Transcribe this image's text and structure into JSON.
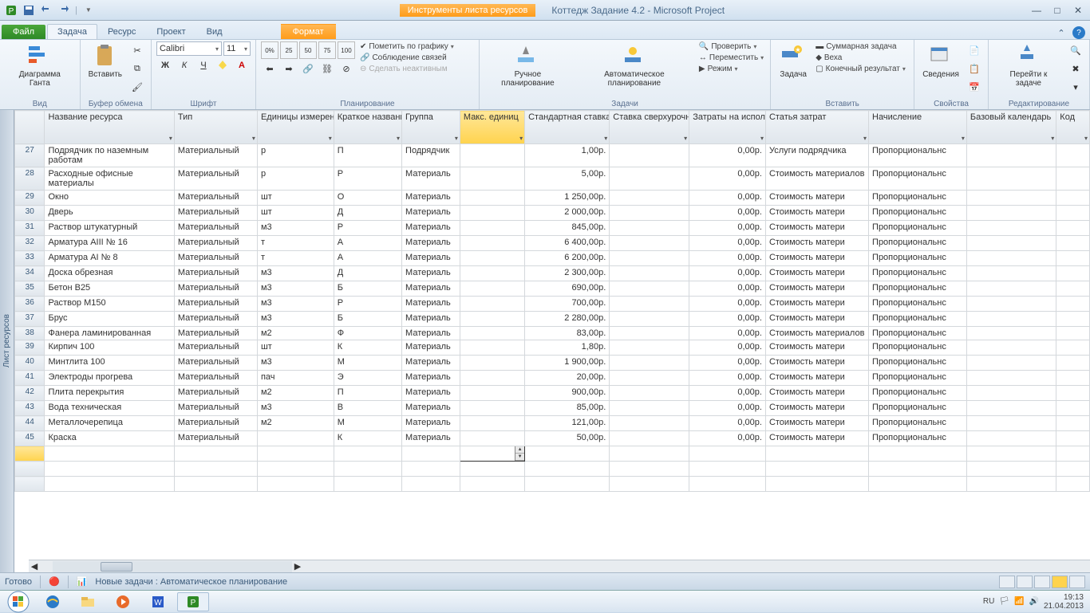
{
  "titlebar": {
    "tool_tab": "Инструменты листа ресурсов",
    "doc_title": "Коттедж Задание 4.2  -  Microsoft Project"
  },
  "tabs": {
    "file": "Файл",
    "items": [
      "Задача",
      "Ресурс",
      "Проект",
      "Вид"
    ],
    "active_index": 0,
    "format": "Формат"
  },
  "ribbon": {
    "view": {
      "gantt": "Диаграмма Ганта",
      "label": "Вид"
    },
    "clipboard": {
      "paste": "Вставить",
      "label": "Буфер обмена"
    },
    "font": {
      "name": "Calibri",
      "size": "11",
      "label": "Шрифт"
    },
    "schedule": {
      "mark": "Пометить по графику",
      "links": "Соблюдение связей",
      "inactive": "Сделать неактивным",
      "label": "Планирование"
    },
    "tasks": {
      "manual": "Ручное планирование",
      "auto": "Автоматическое планирование",
      "check": "Проверить",
      "move": "Переместить",
      "mode": "Режим",
      "label": "Задачи"
    },
    "insert": {
      "task": "Задача",
      "summary": "Суммарная задача",
      "milestone": "Веха",
      "final": "Конечный результат",
      "label": "Вставить"
    },
    "properties": {
      "info": "Сведения",
      "label": "Свойства"
    },
    "editing": {
      "goto": "Перейти к задаче",
      "label": "Редактирование"
    }
  },
  "columns": [
    {
      "label": "",
      "w": 36
    },
    {
      "label": "Название ресурса",
      "w": 156
    },
    {
      "label": "Тип",
      "w": 100
    },
    {
      "label": "Единицы измерения материалов",
      "w": 92
    },
    {
      "label": "Краткое название",
      "w": 82
    },
    {
      "label": "Группа",
      "w": 70
    },
    {
      "label": "Макс. единиц",
      "w": 78,
      "sel": true
    },
    {
      "label": "Стандартная ставка",
      "w": 102
    },
    {
      "label": "Ставка сверхурочных",
      "w": 96
    },
    {
      "label": "Затраты на использ.",
      "w": 92
    },
    {
      "label": "Статья затрат",
      "w": 124
    },
    {
      "label": "Начисление",
      "w": 118
    },
    {
      "label": "Базовый календарь",
      "w": 108
    },
    {
      "label": "Код",
      "w": 40
    }
  ],
  "rows": [
    {
      "n": 27,
      "multi": true,
      "name": "Подрядчик по наземным работам",
      "type": "Материальный",
      "unit": "р",
      "short": "П",
      "group": "Подрядчик",
      "max": "",
      "rate": "1,00р.",
      "ot": "",
      "cost": "0,00р.",
      "cat": "Услуги подрядчика",
      "accr": "Пропорциональнс",
      "cal": ""
    },
    {
      "n": 28,
      "multi": true,
      "name": "Расходные офисные материалы",
      "type": "Материальный",
      "unit": "р",
      "short": "Р",
      "group": "Материаль",
      "max": "",
      "rate": "5,00р.",
      "ot": "",
      "cost": "0,00р.",
      "cat": "Стоимость материалов",
      "accr": "Пропорциональнс",
      "cal": ""
    },
    {
      "n": 29,
      "name": "Окно",
      "type": "Материальный",
      "unit": "шт",
      "short": "О",
      "group": "Материаль",
      "max": "",
      "rate": "1 250,00р.",
      "ot": "",
      "cost": "0,00р.",
      "cat": "Стоимость матери",
      "accr": "Пропорциональнс",
      "cal": ""
    },
    {
      "n": 30,
      "name": "Дверь",
      "type": "Материальный",
      "unit": "шт",
      "short": "Д",
      "group": "Материаль",
      "max": "",
      "rate": "2 000,00р.",
      "ot": "",
      "cost": "0,00р.",
      "cat": "Стоимость матери",
      "accr": "Пропорциональнс",
      "cal": ""
    },
    {
      "n": 31,
      "name": "Раствор штукатурный",
      "type": "Материальный",
      "unit": "м3",
      "short": "Р",
      "group": "Материаль",
      "max": "",
      "rate": "845,00р.",
      "ot": "",
      "cost": "0,00р.",
      "cat": "Стоимость матери",
      "accr": "Пропорциональнс",
      "cal": ""
    },
    {
      "n": 32,
      "name": "Арматура AIII № 16",
      "type": "Материальный",
      "unit": "т",
      "short": "А",
      "group": "Материаль",
      "max": "",
      "rate": "6 400,00р.",
      "ot": "",
      "cost": "0,00р.",
      "cat": "Стоимость матери",
      "accr": "Пропорциональнс",
      "cal": ""
    },
    {
      "n": 33,
      "name": "Арматура AI № 8",
      "type": "Материальный",
      "unit": "т",
      "short": "А",
      "group": "Материаль",
      "max": "",
      "rate": "6 200,00р.",
      "ot": "",
      "cost": "0,00р.",
      "cat": "Стоимость матери",
      "accr": "Пропорциональнс",
      "cal": ""
    },
    {
      "n": 34,
      "name": "Доска обрезная",
      "type": "Материальный",
      "unit": "м3",
      "short": "Д",
      "group": "Материаль",
      "max": "",
      "rate": "2 300,00р.",
      "ot": "",
      "cost": "0,00р.",
      "cat": "Стоимость матери",
      "accr": "Пропорциональнс",
      "cal": ""
    },
    {
      "n": 35,
      "name": "Бетон В25",
      "type": "Материальный",
      "unit": "м3",
      "short": "Б",
      "group": "Материаль",
      "max": "",
      "rate": "690,00р.",
      "ot": "",
      "cost": "0,00р.",
      "cat": "Стоимость матери",
      "accr": "Пропорциональнс",
      "cal": ""
    },
    {
      "n": 36,
      "name": "Раствор М150",
      "type": "Материальный",
      "unit": "м3",
      "short": "Р",
      "group": "Материаль",
      "max": "",
      "rate": "700,00р.",
      "ot": "",
      "cost": "0,00р.",
      "cat": "Стоимость матери",
      "accr": "Пропорциональнс",
      "cal": ""
    },
    {
      "n": 37,
      "name": "Брус",
      "type": "Материальный",
      "unit": "м3",
      "short": "Б",
      "group": "Материаль",
      "max": "",
      "rate": "2 280,00р.",
      "ot": "",
      "cost": "0,00р.",
      "cat": "Стоимость матери",
      "accr": "Пропорциональнс",
      "cal": ""
    },
    {
      "n": 38,
      "multi": true,
      "name": "Фанера ламинированная",
      "type": "Материальный",
      "unit": "м2",
      "short": "Ф",
      "group": "Материаль",
      "max": "",
      "rate": "83,00р.",
      "ot": "",
      "cost": "0,00р.",
      "cat": "Стоимость материалов",
      "accr": "Пропорциональнс",
      "cal": ""
    },
    {
      "n": 39,
      "name": "Кирпич 100",
      "type": "Материальный",
      "unit": "шт",
      "short": "К",
      "group": "Материаль",
      "max": "",
      "rate": "1,80р.",
      "ot": "",
      "cost": "0,00р.",
      "cat": "Стоимость матери",
      "accr": "Пропорциональнс",
      "cal": ""
    },
    {
      "n": 40,
      "name": "Минтлита 100",
      "type": "Материальный",
      "unit": "м3",
      "short": "М",
      "group": "Материаль",
      "max": "",
      "rate": "1 900,00р.",
      "ot": "",
      "cost": "0,00р.",
      "cat": "Стоимость матери",
      "accr": "Пропорциональнс",
      "cal": ""
    },
    {
      "n": 41,
      "name": "Электроды прогрева",
      "type": "Материальный",
      "unit": "пач",
      "short": "Э",
      "group": "Материаль",
      "max": "",
      "rate": "20,00р.",
      "ot": "",
      "cost": "0,00р.",
      "cat": "Стоимость матери",
      "accr": "Пропорциональнс",
      "cal": ""
    },
    {
      "n": 42,
      "name": "Плита перекрытия",
      "type": "Материальный",
      "unit": "м2",
      "short": "П",
      "group": "Материаль",
      "max": "",
      "rate": "900,00р.",
      "ot": "",
      "cost": "0,00р.",
      "cat": "Стоимость матери",
      "accr": "Пропорциональнс",
      "cal": ""
    },
    {
      "n": 43,
      "name": "Вода техническая",
      "type": "Материальный",
      "unit": "м3",
      "short": "В",
      "group": "Материаль",
      "max": "",
      "rate": "85,00р.",
      "ot": "",
      "cost": "0,00р.",
      "cat": "Стоимость матери",
      "accr": "Пропорциональнс",
      "cal": ""
    },
    {
      "n": 44,
      "name": "Металлочерепица",
      "type": "Материальный",
      "unit": "м2",
      "short": "М",
      "group": "Материаль",
      "max": "",
      "rate": "121,00р.",
      "ot": "",
      "cost": "0,00р.",
      "cat": "Стоимость матери",
      "accr": "Пропорциональнс",
      "cal": ""
    },
    {
      "n": 45,
      "name": "Краска",
      "type": "Материальный",
      "unit": "",
      "short": "К",
      "group": "Материаль",
      "max": "",
      "rate": "50,00р.",
      "ot": "",
      "cost": "0,00р.",
      "cat": "Стоимость матери",
      "accr": "Пропорциональнс",
      "cal": ""
    }
  ],
  "sidebar_label": "Лист ресурсов",
  "statusbar": {
    "ready": "Готово",
    "newtasks": "Новые задачи : Автоматическое планирование"
  },
  "tray": {
    "lang": "RU",
    "time": "19:13",
    "date": "21.04.2013"
  }
}
